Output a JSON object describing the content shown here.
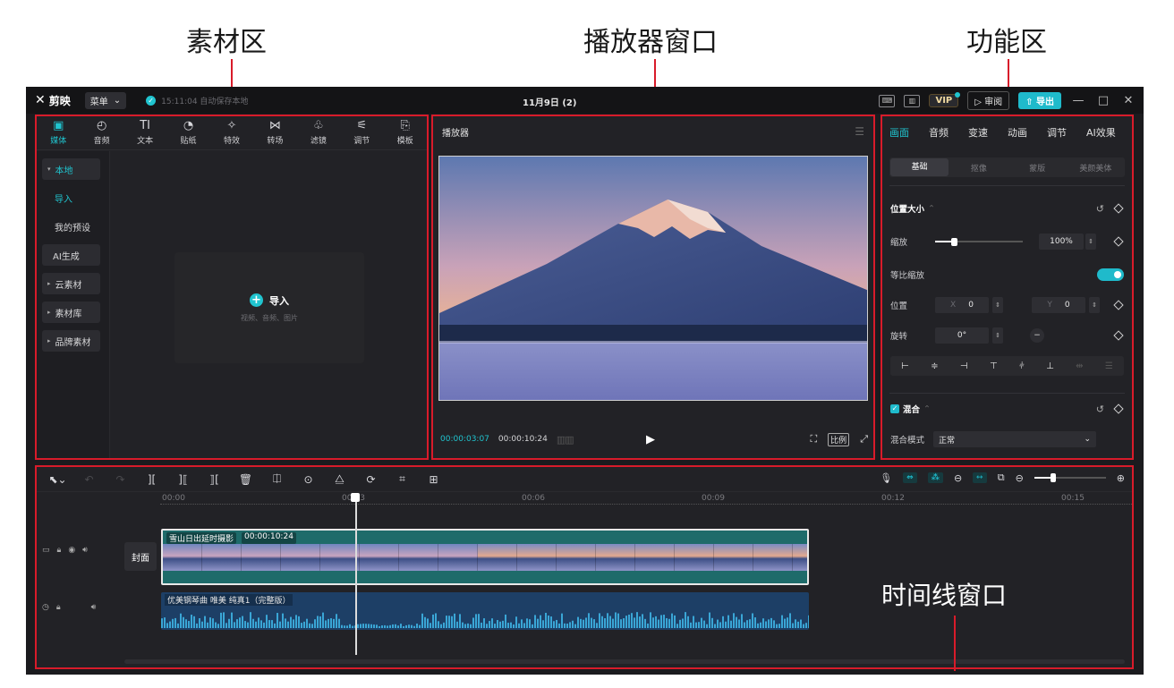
{
  "annotations": {
    "media_area": "素材区",
    "player_window": "播放器窗口",
    "function_area": "功能区",
    "timeline_window": "时间线窗口"
  },
  "topbar": {
    "app_name": "剪映",
    "menu_label": "菜单",
    "save_status": "15:11:04 自动保存本地",
    "doc_title": "11月9日 (2)",
    "vip_label": "VIP",
    "review_label": "审阅",
    "export_label": "导出"
  },
  "media_tools": [
    {
      "label": "媒体",
      "icon": "media-icon"
    },
    {
      "label": "音频",
      "icon": "audio-icon"
    },
    {
      "label": "文本",
      "icon": "text-icon"
    },
    {
      "label": "贴纸",
      "icon": "sticker-icon"
    },
    {
      "label": "特效",
      "icon": "effects-icon"
    },
    {
      "label": "转场",
      "icon": "transition-icon"
    },
    {
      "label": "滤镜",
      "icon": "filter-icon"
    },
    {
      "label": "调节",
      "icon": "adjust-icon"
    },
    {
      "label": "模板",
      "icon": "template-icon"
    }
  ],
  "media_sidebar": {
    "local": "本地",
    "import": "导入",
    "my_presets": "我的预设",
    "ai_generate": "AI生成",
    "cloud": "云素材",
    "library": "素材库",
    "brand": "品牌素材"
  },
  "import_card": {
    "label": "导入",
    "hint": "视频、音频、图片"
  },
  "player": {
    "title": "播放器",
    "current_time": "00:00:03:07",
    "total_time": "00:00:10:24",
    "ratio_label": "比例"
  },
  "properties": {
    "tabs": [
      "画面",
      "音频",
      "变速",
      "动画",
      "调节",
      "AI效果"
    ],
    "sub_tabs": [
      "基础",
      "抠像",
      "蒙版",
      "美颜美体"
    ],
    "section_position": "位置大小",
    "scale_label": "缩放",
    "scale_value": "100%",
    "scale_fraction": 0.22,
    "uniform_scale_label": "等比缩放",
    "position_label": "位置",
    "pos_x_axis": "X",
    "pos_x": "0",
    "pos_y_axis": "Y",
    "pos_y": "0",
    "rotation_label": "旋转",
    "rotation_value": "0°",
    "blend_label": "混合",
    "blend_mode_label": "混合模式",
    "blend_mode_value": "正常"
  },
  "timeline": {
    "ruler": [
      "00:00",
      "00:03",
      "00:06",
      "00:09",
      "00:12",
      "00:15"
    ],
    "cover_label": "封面",
    "video_clip_name": "雪山日出延时摄影",
    "video_clip_duration": "00:00:10:24",
    "audio_clip_name": "优美钢琴曲 唯美 纯真1（完整版）"
  },
  "colors": {
    "accent": "#20c4cf",
    "annotation_border": "#d81b2a",
    "video_track": "#1e6b6a",
    "audio_track": "#1d3f66"
  }
}
